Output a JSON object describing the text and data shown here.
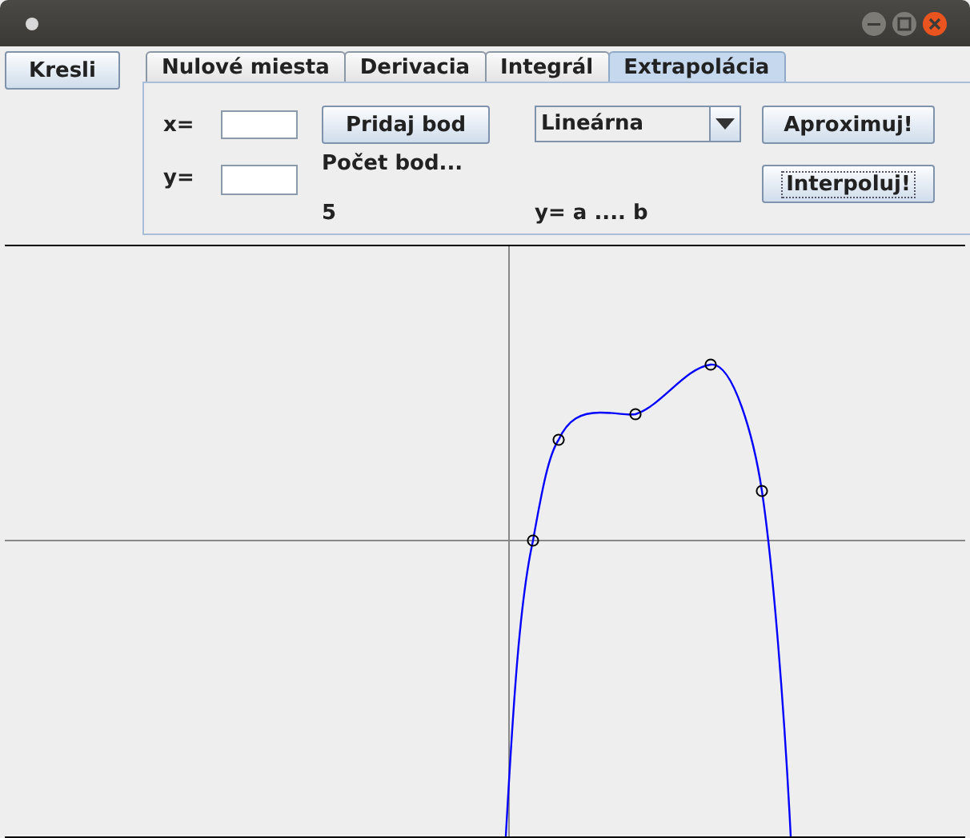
{
  "toolbar": {
    "draw_button": "Kresli"
  },
  "tabs": [
    {
      "label": "Nulové miesta",
      "selected": false
    },
    {
      "label": "Derivacia",
      "selected": false
    },
    {
      "label": "Integrál",
      "selected": false
    },
    {
      "label": "Extrapolácia",
      "selected": true
    }
  ],
  "form": {
    "x_label": "x=",
    "y_label": "y=",
    "add_button": "Pridaj bod",
    "count_label": "Počet bod...",
    "count": "5",
    "method": "Lineárna",
    "formula": "y= a .... b",
    "approximate_button": "Aproximuj!",
    "interpolate_button": "Interpoluj!"
  }
}
